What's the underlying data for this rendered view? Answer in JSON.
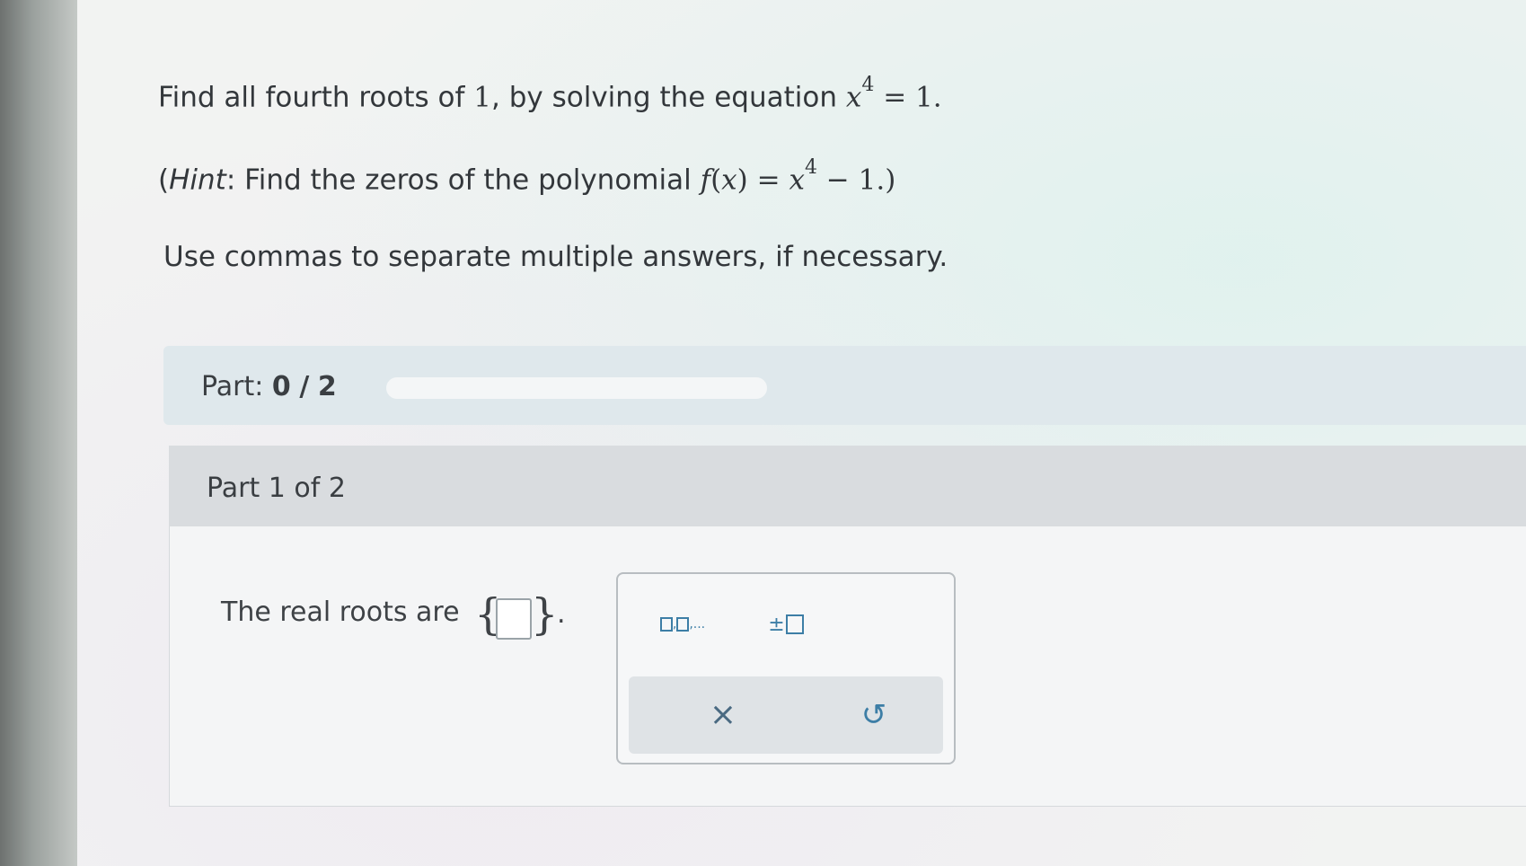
{
  "question": {
    "line1_prefix": "Find all fourth roots of",
    "line1_one": "1",
    "line1_middle": ", by solving the equation",
    "line1_var": "x",
    "line1_exp": "4",
    "line1_eq": "= 1.",
    "hint_open": "(",
    "hint_word": "Hint",
    "hint_text": ": Find the zeros of the polynomial",
    "hint_f": "f",
    "hint_paren_open": "(",
    "hint_x": "x",
    "hint_paren_close": ")",
    "hint_eq": " = ",
    "hint_var": "x",
    "hint_exp": "4",
    "hint_tail": " − 1.)",
    "instruction": "Use commas to separate multiple answers, if necessary."
  },
  "progress": {
    "label": "Part:",
    "completed": "0",
    "separator": "/",
    "total": "2",
    "fraction": 0
  },
  "part": {
    "title": "Part 1 of 2",
    "answer_label": "The real roots are",
    "brace_open": "{",
    "brace_close": "}",
    "period": "."
  },
  "keypad": {
    "list_key_suffix": ",...",
    "plus_minus_symbol": "±",
    "clear_symbol": "×",
    "undo_symbol": "↺"
  },
  "colors": {
    "accent": "#3d7ea6",
    "progress_bar": "#dfe8ec",
    "part_header": "#d9dcdf"
  }
}
